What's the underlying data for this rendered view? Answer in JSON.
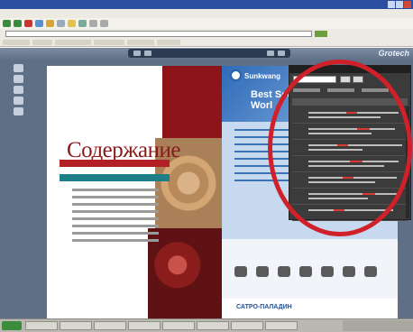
{
  "browser": {
    "window_title": "",
    "menu": [
      "",
      "",
      "",
      "",
      "",
      ""
    ],
    "address_label": "",
    "address_url": ""
  },
  "viewer": {
    "brand": "Grotech"
  },
  "magazine": {
    "left_page": {
      "title": "Содержание",
      "corner_word": ""
    },
    "right_page": {
      "logo": "Sunkwang",
      "headline_line1": "Best Securi",
      "headline_line2": "Worl",
      "footer_logo": "САТРО-ПАЛАДИН"
    }
  },
  "search_panel": {
    "header": "",
    "query": "",
    "columns": [
      "",
      ""
    ],
    "results": [
      {
        "page": ""
      },
      {
        "page": ""
      },
      {
        "page": ""
      },
      {
        "page": ""
      },
      {
        "page": ""
      },
      {
        "page": ""
      },
      {
        "page": ""
      }
    ]
  },
  "annotation": {
    "color": "#d0202a"
  },
  "taskbar": {
    "clock": ""
  },
  "colors": {
    "title_bar": "#2a4fa0",
    "toc_red": "#8b1a1c",
    "toc_teal": "#1f7f88",
    "page_blue": "#5a8ccb",
    "panel_dark": "#3b3b3b"
  }
}
